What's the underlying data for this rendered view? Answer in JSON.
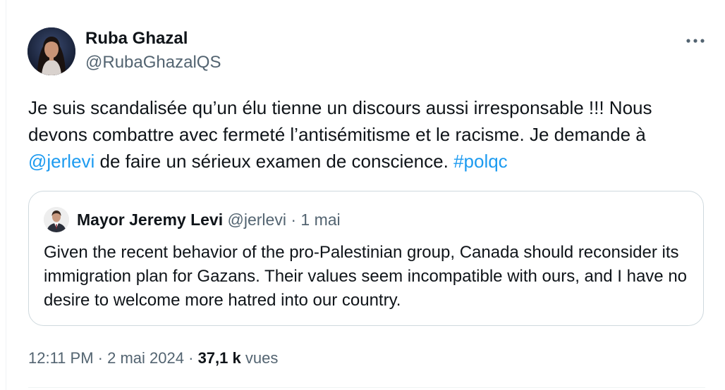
{
  "author": {
    "display_name": "Ruba Ghazal",
    "handle": "@RubaGhazalQS"
  },
  "tweet": {
    "text_part1": "Je suis scandalisée qu’un élu tienne un discours aussi irresponsable !!! Nous devons combattre avec fermeté l’antisémitisme et le racisme. Je demande à ",
    "mention": "@jerlevi",
    "text_part2": " de faire un sérieux examen de conscience. ",
    "hashtag": "#polqc"
  },
  "quoted": {
    "display_name": "Mayor Jeremy Levi",
    "handle": "@jerlevi",
    "separator": "·",
    "date": "1 mai",
    "text": "Given the recent behavior of the pro-Palestinian group, Canada should reconsider its immigration plan for Gazans. Their values seem incompatible with ours, and I have no desire to welcome more hatred into our country."
  },
  "meta": {
    "time": "12:11 PM",
    "separator": "·",
    "date": "2 mai 2024",
    "views_count": "37,1 k",
    "views_label": "vues"
  },
  "colors": {
    "link": "#1d9bf0",
    "secondary_text": "#536471",
    "primary_text": "#0f1419",
    "border": "#cfd9de"
  },
  "icons": {
    "more": "more-horizontal-icon"
  }
}
